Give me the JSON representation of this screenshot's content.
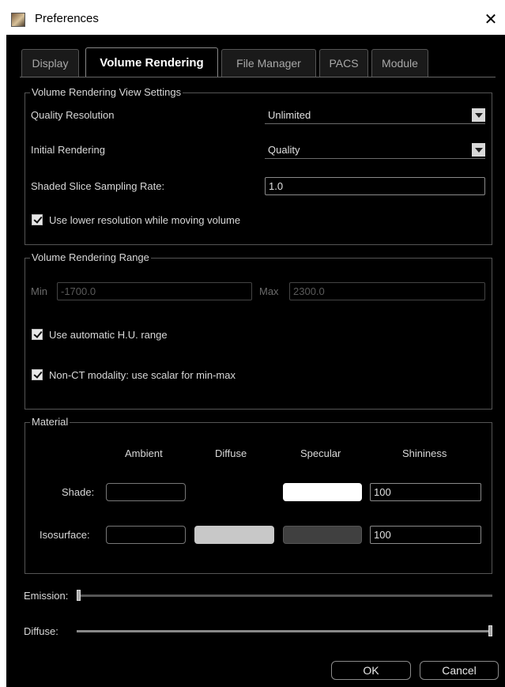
{
  "window": {
    "title": "Preferences",
    "close_glyph": "✕"
  },
  "tabs": [
    {
      "label": "Display",
      "active": false
    },
    {
      "label": "Volume Rendering",
      "active": true
    },
    {
      "label": "File Manager",
      "active": false
    },
    {
      "label": "PACS",
      "active": false
    },
    {
      "label": "Module",
      "active": false
    }
  ],
  "view_settings": {
    "title": "Volume Rendering View Settings",
    "quality_resolution_label": "Quality Resolution",
    "quality_resolution_value": "Unlimited",
    "initial_rendering_label": "Initial Rendering",
    "initial_rendering_value": "Quality",
    "sampling_rate_label": "Shaded Slice Sampling Rate:",
    "sampling_rate_value": "1.0",
    "lower_res_label": "Use lower resolution while moving volume",
    "lower_res_checked": true
  },
  "range": {
    "title": "Volume Rendering Range",
    "min_label": "Min",
    "min_value": "-1700.0",
    "max_label": "Max",
    "max_value": "2300.0",
    "auto_hu_label": "Use automatic H.U. range",
    "auto_hu_checked": true,
    "non_ct_label": "Non-CT modality: use scalar for min-max",
    "non_ct_checked": true
  },
  "material": {
    "title": "Material",
    "col_ambient": "Ambient",
    "col_diffuse": "Diffuse",
    "col_specular": "Specular",
    "col_shininess": "Shininess",
    "shade_label": "Shade:",
    "shade_shininess": "100",
    "isosurface_label": "Isosurface:",
    "iso_shininess": "100",
    "colors": {
      "shade_ambient": "#000000",
      "shade_specular": "#ffffff",
      "iso_ambient": "#000000",
      "iso_diffuse": "#c8c8c8",
      "iso_specular": "#404040"
    }
  },
  "sliders": {
    "emission_label": "Emission:",
    "emission_level": 0.0,
    "diffuse_label": "Diffuse:",
    "diffuse_level": 1.0
  },
  "buttons": {
    "ok": "OK",
    "cancel": "Cancel"
  }
}
